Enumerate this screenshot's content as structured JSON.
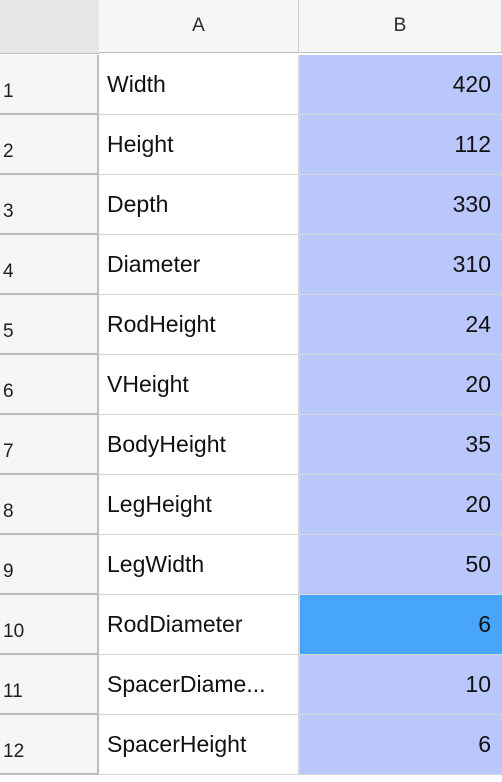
{
  "columns": [
    "A",
    "B"
  ],
  "active_cell": "B10",
  "colors": {
    "selection": "#b9c7fb",
    "active": "#47a5fb",
    "header": "#f6f6f6"
  },
  "rows": [
    {
      "num": "1",
      "label": "Width",
      "value": "420"
    },
    {
      "num": "2",
      "label": "Height",
      "value": "112"
    },
    {
      "num": "3",
      "label": "Depth",
      "value": "330"
    },
    {
      "num": "4",
      "label": "Diameter",
      "value": "310"
    },
    {
      "num": "5",
      "label": "RodHeight",
      "value": "24"
    },
    {
      "num": "6",
      "label": "VHeight",
      "value": "20"
    },
    {
      "num": "7",
      "label": "BodyHeight",
      "value": "35"
    },
    {
      "num": "8",
      "label": "LegHeight",
      "value": "20"
    },
    {
      "num": "9",
      "label": "LegWidth",
      "value": "50"
    },
    {
      "num": "10",
      "label": "RodDiameter",
      "value": "6"
    },
    {
      "num": "11",
      "label": "SpacerDiame...",
      "value": "10"
    },
    {
      "num": "12",
      "label": "SpacerHeight",
      "value": "6"
    }
  ]
}
